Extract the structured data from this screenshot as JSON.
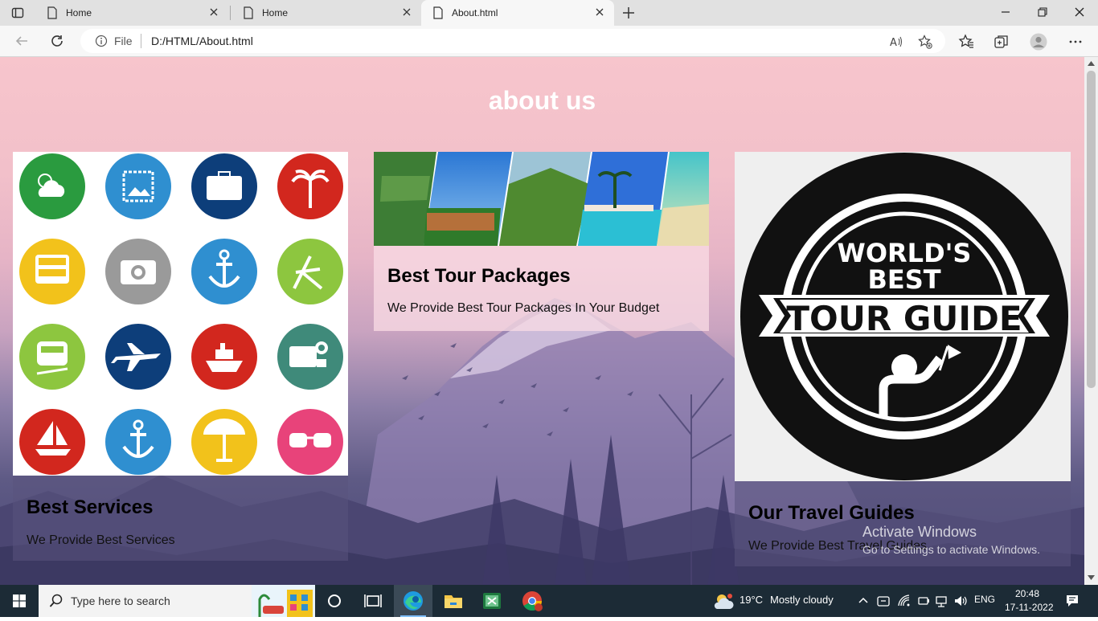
{
  "browser": {
    "tabs": [
      {
        "label": "Home",
        "active": false
      },
      {
        "label": "Home",
        "active": false
      },
      {
        "label": "About.html",
        "active": true
      }
    ],
    "address": {
      "protocol_label": "File",
      "url": "D:/HTML/About.html"
    }
  },
  "page": {
    "heading": "about us",
    "cards": [
      {
        "title": "Best Services",
        "description": "We Provide Best Services"
      },
      {
        "title": "Best Tour Packages",
        "description": "We Provide Best Tour Packages In Your Budget"
      },
      {
        "title": "Our Travel Guides",
        "description": "We Provide Best Travel Guides"
      }
    ],
    "badge": {
      "line1": "WORLD'S",
      "line2": "BEST",
      "line3": "TOUR GUIDE"
    }
  },
  "watermark": {
    "line1": "Activate Windows",
    "line2": "Go to Settings to activate Windows."
  },
  "taskbar": {
    "search_placeholder": "Type here to search",
    "weather": {
      "temp": "19°C",
      "condition": "Mostly cloudy"
    },
    "language": "ENG",
    "time": "20:48",
    "date": "17-11-2022"
  },
  "colors": {
    "accent": "#0078d4",
    "taskbar": "#1c2b36"
  }
}
